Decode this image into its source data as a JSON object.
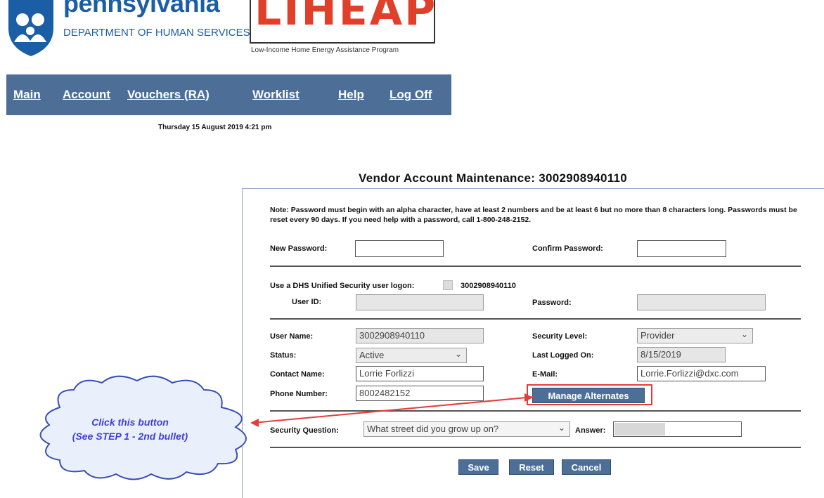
{
  "header": {
    "pa_brand": "pennsylvania",
    "pa_department": "DEPARTMENT OF HUMAN SERVICES",
    "liheap_logo": "LIHEAP",
    "liheap_subtitle": "Low-Income Home Energy Assistance Program"
  },
  "nav": {
    "items": [
      {
        "label": "Main"
      },
      {
        "label": "Account"
      },
      {
        "label": "Vouchers (RA)"
      },
      {
        "label": "Worklist"
      },
      {
        "label": "Help"
      },
      {
        "label": "Log Off"
      }
    ],
    "date": "Thursday 15 August 2019 4:21 pm"
  },
  "page": {
    "title": "Vendor Account Maintenance:  3002908940110"
  },
  "form": {
    "note": "Note: Password must begin with an alpha character, have at least 2 numbers and be at least 6 but no more than 8 characters long. Passwords must be reset every 90 days. If you need help with a password, call 1-800-248-2152.",
    "new_password_label": "New Password:",
    "new_password_value": "",
    "confirm_password_label": "Confirm Password:",
    "confirm_password_value": "",
    "unified_label": "Use a DHS Unified Security user logon:",
    "unified_id": "3002908940110",
    "user_id_label": "User ID:",
    "user_id_value": "",
    "password_label": "Password:",
    "password_value": "",
    "user_name_label": "User Name:",
    "user_name_value": "3002908940110",
    "security_level_label": "Security Level:",
    "security_level_value": "Provider",
    "status_label": "Status:",
    "status_value": "Active",
    "last_logged_label": "Last Logged On:",
    "last_logged_value": "8/15/2019",
    "contact_name_label": "Contact Name:",
    "contact_name_value": "Lorrie Forlizzi",
    "email_label": "E-Mail:",
    "email_value": "Lorrie.Forlizzi@dxc.com",
    "phone_label": "Phone Number:",
    "phone_value": "8002482152",
    "manage_alternates_label": "Manage Alternates",
    "security_question_label": "Security Question:",
    "security_question_value": "What street did you grow up on?",
    "answer_label": "Answer:",
    "answer_value": "",
    "save_label": "Save",
    "reset_label": "Reset",
    "cancel_label": "Cancel"
  },
  "annotation": {
    "line1": "Click this button",
    "line2": "(See STEP 1 - 2nd bullet)",
    "color": "#3f3fd6",
    "highlight_color": "#e63b3b"
  },
  "colors": {
    "nav_bg": "#4d6f97",
    "pa_blue": "#1b5ea6",
    "liheap_red": "#e0402a"
  }
}
